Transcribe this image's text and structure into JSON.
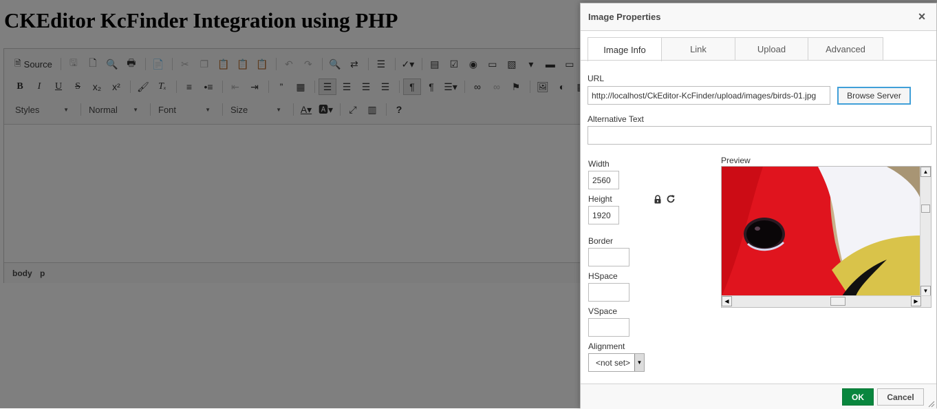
{
  "page": {
    "title": "CKEditor KcFinder Integration using PHP"
  },
  "toolbar": {
    "source_label": "Source",
    "styles_label": "Styles",
    "format_label": "Normal",
    "font_label": "Font",
    "size_label": "Size",
    "bold": "B",
    "italic": "I",
    "underline": "U",
    "strike": "S",
    "help": "?"
  },
  "statusbar": {
    "path": [
      "body",
      "p"
    ]
  },
  "dialog": {
    "title": "Image Properties",
    "close": "×",
    "tabs": [
      "Image Info",
      "Link",
      "Upload",
      "Advanced"
    ],
    "url_label": "URL",
    "url_value": "http://localhost/CkEditor-KcFinder/upload/images/birds-01.jpg",
    "browse_label": "Browse Server",
    "alt_label": "Alternative Text",
    "alt_value": "",
    "width_label": "Width",
    "width_value": "2560",
    "height_label": "Height",
    "height_value": "1920",
    "border_label": "Border",
    "border_value": "",
    "hspace_label": "HSpace",
    "hspace_value": "",
    "vspace_label": "VSpace",
    "vspace_value": "",
    "alignment_label": "Alignment",
    "alignment_value": "<not set>",
    "preview_label": "Preview",
    "preview_scroll": {
      "vertical": 0.27,
      "horizontal": 0.6
    },
    "ok_label": "OK",
    "cancel_label": "Cancel"
  },
  "colors": {
    "ok": "#09863e",
    "focus": "#409fd8",
    "overlay": "rgba(0,0,0,0.5)"
  }
}
